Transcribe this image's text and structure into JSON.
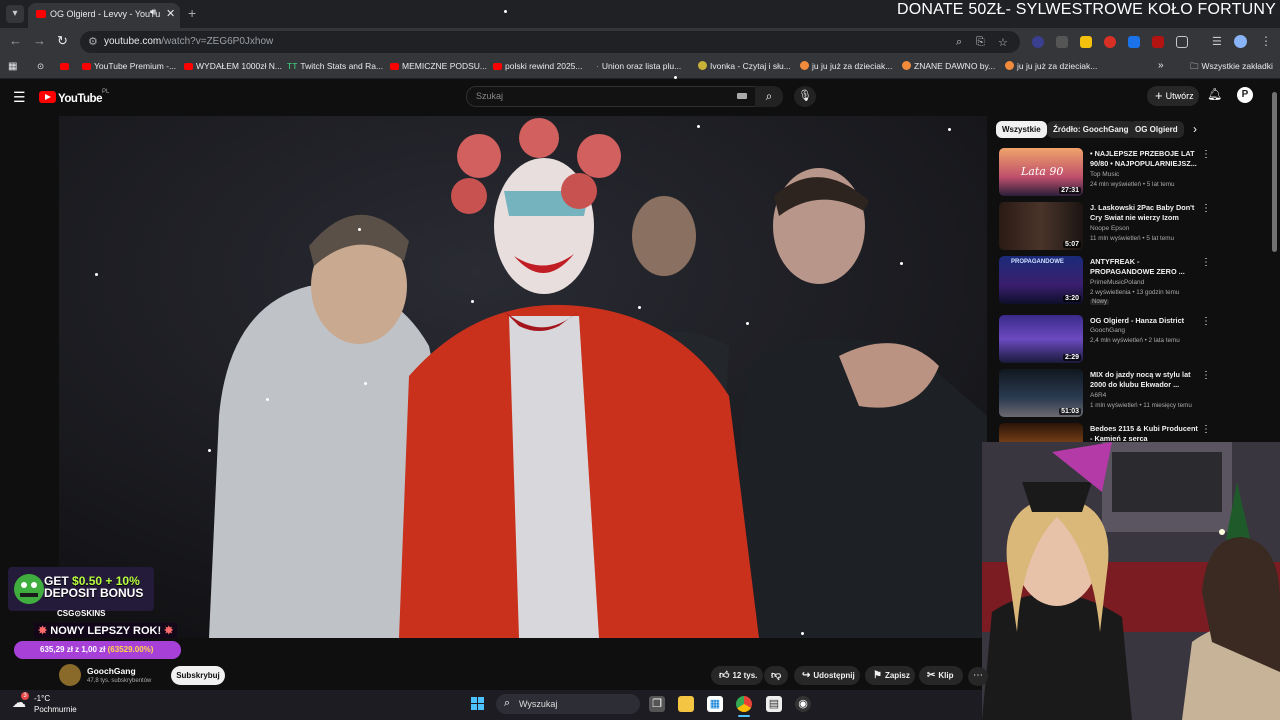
{
  "browser": {
    "active_tab_title": "OG Olgierd - Levvy - YouTu",
    "new_tab_symbol": "+",
    "url_host": "youtube.com",
    "url_path": "/watch?v=ZEG6P0Jxhow",
    "bookmarks": [
      "YouTube Premium -...",
      "WYDAŁEM 1000zł N...",
      "Twitch Stats and Ra...",
      "MEMICZNE PODSU...",
      "polski rewind 2025...",
      "Union oraz lista plu...",
      "Ivonka - Czytaj i słu...",
      "ju ju już za dzieciak...",
      "ZNANE DAWNO by...",
      "ju ju już za dzieciak..."
    ],
    "all_bookmarks_label": "Wszystkie zakładki"
  },
  "stream_overlay": {
    "donate_banner": "DONATE 50ZŁ- SYLWESTROWE KOŁO FORTUNY",
    "ad_headline_1": "GET ",
    "ad_headline_2": "$0.50 + 10%",
    "ad_headline_3": "DEPOSIT BONUS",
    "ad_brand": "CSG⊙SKINS",
    "new_year_text": "NOWY LEPSZY ROK!",
    "goal_amount": "635,29 zł z 1,00 zł",
    "goal_percent_text": "(63529.00%)",
    "goal_progress": 1.0
  },
  "youtube": {
    "logo_text": "YouTube",
    "logo_region": "PL",
    "search_placeholder": "Szukaj",
    "create_label": "Utwórz",
    "chips": [
      "Wszystkie",
      "Źródło: GoochGang",
      "OG Olgierd"
    ],
    "recommendations": [
      {
        "title": "• NAJLEPSZE PRZEBOJE LAT 90/80 • NAJPOPULARNIEJSZ...",
        "channel": "Top Music",
        "meta": "24 mln wyświetleń • 5 lat temu",
        "duration": "27:31",
        "thumb_text": "Lata 90",
        "badge": ""
      },
      {
        "title": "J. Laskowski  2Pac Baby Don't Cry Swiat nie wierzy Izom",
        "channel": "Noope Epson",
        "meta": "11 mln wyświetleń • 5 lat temu",
        "duration": "5:07",
        "thumb_text": "",
        "badge": ""
      },
      {
        "title": "ANTYFREAK - PROPAGANDOWE ZERO ...",
        "channel": "PrimeMusicPoland",
        "meta": "2 wyświetlenia • 13 godzin temu",
        "duration": "3:20",
        "thumb_text": "PROPAGANDOWE",
        "badge": "Nowy"
      },
      {
        "title": "OG Olgierd - Hanza District",
        "channel": "GoochGang",
        "meta": "2,4 mln wyświetleń • 2 lata temu",
        "duration": "2:29",
        "thumb_text": "",
        "badge": ""
      },
      {
        "title": "MIX do jazdy nocą w stylu lat 2000 do klubu Ekwador ...",
        "channel": "A6R4",
        "meta": "1 mln wyświetleń • 11 miesięcy temu",
        "duration": "51:03",
        "thumb_text": "",
        "badge": ""
      },
      {
        "title": "Bedoes 2115 & Kubi Producent - Kamień z serca",
        "channel": "",
        "meta": "",
        "duration": "",
        "thumb_text": "",
        "badge": ""
      }
    ],
    "channel_name": "GoochGang",
    "channel_subs": "47,8 tys. subskrybentów",
    "subscribe_label": "Subskrybuj",
    "likes": "12 tys.",
    "share_label": "Udostępnij",
    "save_label": "Zapisz",
    "clip_label": "Klip"
  },
  "taskbar": {
    "temperature": "-1°C",
    "condition": "Pochmurnie",
    "notification_count": "3",
    "search_label": "Wyszukaj"
  },
  "colors": {
    "youtube_red": "#ff0000",
    "goal_purple": "#a640d6",
    "ad_green": "#b8ff3f"
  }
}
